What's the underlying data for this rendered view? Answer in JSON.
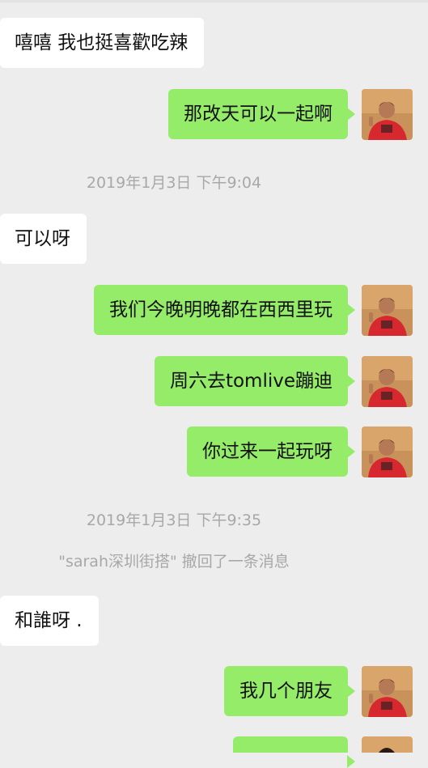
{
  "messages": [
    {
      "side": "in",
      "text": "嘻嘻 我也挺喜歡吃辣"
    },
    {
      "side": "out",
      "text": "那改天可以一起啊"
    },
    {
      "time": "2019年1月3日 下午9:04"
    },
    {
      "side": "in",
      "text": "可以呀"
    },
    {
      "side": "out",
      "text": "我们今晚明晚都在西西里玩"
    },
    {
      "side": "out",
      "text": "周六去tomlive蹦迪"
    },
    {
      "side": "out",
      "text": "你过来一起玩呀"
    },
    {
      "time": "2019年1月3日 下午9:35"
    },
    {
      "system": "\"sarah深圳街搭\" 撤回了一条消息"
    },
    {
      "side": "in",
      "text": "和誰呀 ."
    },
    {
      "side": "out",
      "text": "我几个朋友"
    },
    {
      "side": "out",
      "text": ""
    }
  ],
  "colors": {
    "background": "#ededed",
    "incoming_bubble": "#ffffff",
    "outgoing_bubble": "#95ec69",
    "timestamp_text": "#a8a8a8"
  }
}
